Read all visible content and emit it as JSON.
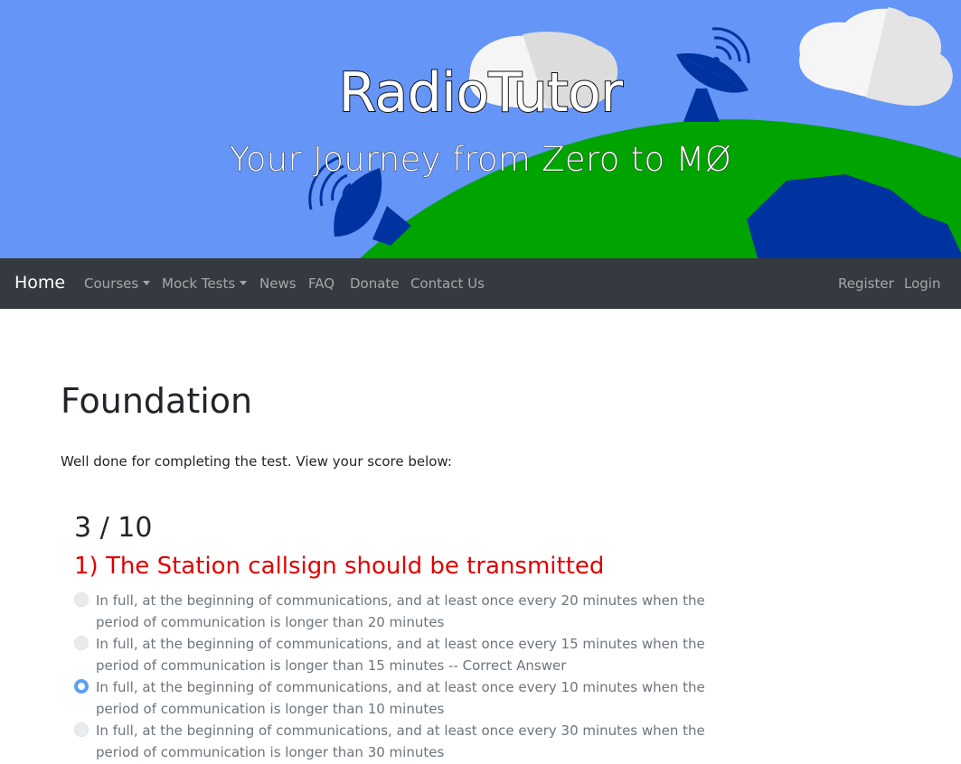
{
  "header": {
    "title": "RadioTutor",
    "subtitle": "Your Journey from Zero to MØ"
  },
  "nav": {
    "brand": "Home",
    "items": [
      {
        "label": "Courses",
        "dropdown": true
      },
      {
        "label": "Mock Tests",
        "dropdown": true
      },
      {
        "label": "News",
        "dropdown": false
      },
      {
        "label": "FAQ",
        "dropdown": false
      },
      {
        "label": "Donate",
        "dropdown": false
      },
      {
        "label": "Contact Us",
        "dropdown": false
      }
    ],
    "right": [
      "Register",
      "Login"
    ]
  },
  "main": {
    "title": "Foundation",
    "intro": "Well done for completing the test. View your score below:",
    "score": "3 / 10",
    "questions": [
      {
        "text": "1) The Station callsign should be transmitted",
        "answers": [
          {
            "text": "In full, at the beginning of communications, and at least once every 20 minutes when the period of communication is longer than 20 minutes",
            "selected": false
          },
          {
            "text": "In full, at the beginning of communications, and at least once every 15 minutes when the period of communication is longer than 15 minutes -- Correct Answer",
            "selected": false
          },
          {
            "text": "In full, at the beginning of communications, and at least once every 10 minutes when the period of communication is longer than 10 minutes",
            "selected": true
          },
          {
            "text": "In full, at the beginning of communications, and at least once every 30 minutes when the period of communication is longer than 30 minutes",
            "selected": false
          }
        ]
      }
    ]
  },
  "colors": {
    "sky": "#6495f7",
    "earth": "#00a400",
    "ocean": "#0033a0",
    "navbar": "#343a40",
    "wrong_question": "#e00000",
    "selected_radio": "#5aa2f5"
  },
  "icons": [
    "satellite-dish-icon",
    "cloud-icon",
    "caret-down-icon",
    "radio-button-icon"
  ]
}
